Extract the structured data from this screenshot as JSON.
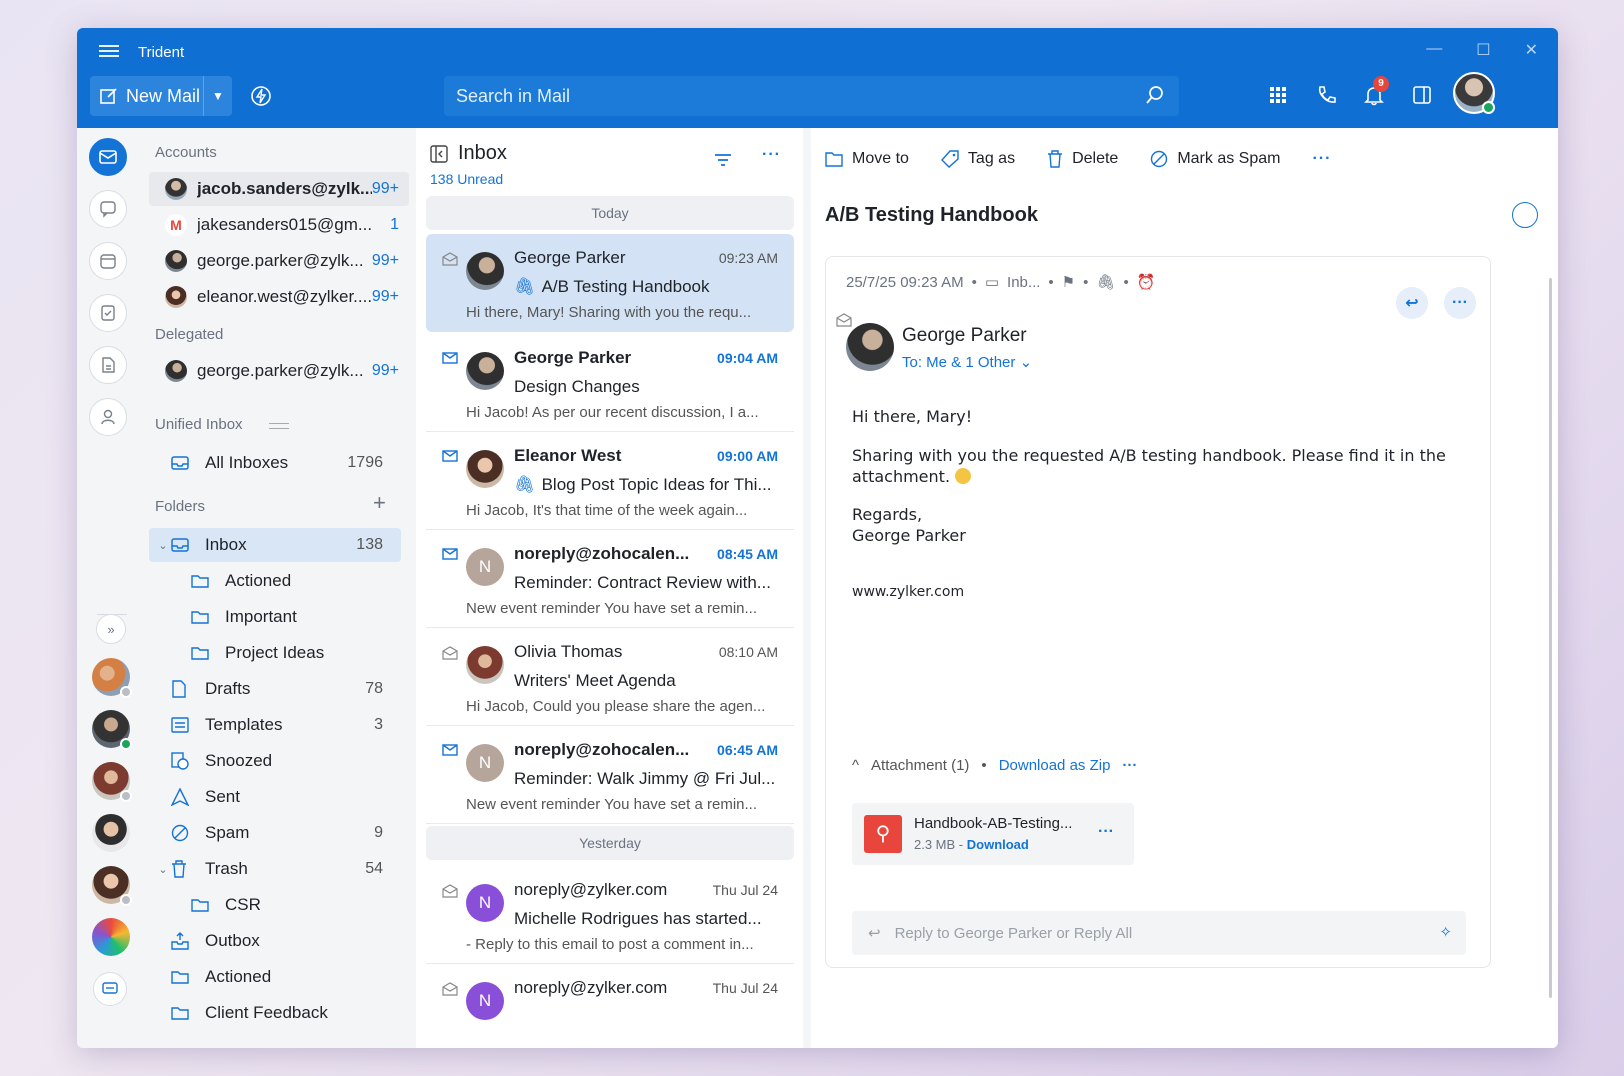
{
  "app": {
    "title": "Trident"
  },
  "toolbar_top": {
    "new_mail": "New Mail",
    "search_placeholder": "Search in Mail",
    "notification_count": "9"
  },
  "accounts": {
    "label": "Accounts",
    "items": [
      {
        "name": "jacob.sanders@zylk...",
        "count": "99+"
      },
      {
        "name": "jakesanders015@gm...",
        "count": "1"
      },
      {
        "name": "george.parker@zylk...",
        "count": "99+"
      },
      {
        "name": "eleanor.west@zylker....",
        "count": "99+"
      }
    ],
    "delegated_label": "Delegated",
    "delegated": [
      {
        "name": "george.parker@zylk...",
        "count": "99+"
      }
    ]
  },
  "unified": {
    "label": "Unified Inbox",
    "all_inboxes": "All Inboxes",
    "all_count": "1796"
  },
  "folders": {
    "label": "Folders",
    "items": [
      {
        "name": "Inbox",
        "count": "138"
      },
      {
        "name": "Actioned",
        "count": ""
      },
      {
        "name": "Important",
        "count": ""
      },
      {
        "name": "Project Ideas",
        "count": ""
      },
      {
        "name": "Drafts",
        "count": "78"
      },
      {
        "name": "Templates",
        "count": "3"
      },
      {
        "name": "Snoozed",
        "count": ""
      },
      {
        "name": "Sent",
        "count": ""
      },
      {
        "name": "Spam",
        "count": "9"
      },
      {
        "name": "Trash",
        "count": "54"
      },
      {
        "name": "CSR",
        "count": ""
      },
      {
        "name": "Outbox",
        "count": ""
      },
      {
        "name": "Actioned",
        "count": ""
      },
      {
        "name": "Client Feedback",
        "count": ""
      }
    ]
  },
  "list": {
    "title": "Inbox",
    "unread": "138 Unread",
    "today": "Today",
    "yesterday": "Yesterday",
    "mails": [
      {
        "from": "George Parker",
        "time": "09:23 AM",
        "subject": "A/B Testing Handbook",
        "preview": "Hi there, Mary! Sharing with you the requ...",
        "initial": ""
      },
      {
        "from": "George Parker",
        "time": "09:04 AM",
        "subject": "Design Changes",
        "preview": "Hi Jacob! As per our recent discussion, I a...",
        "initial": ""
      },
      {
        "from": "Eleanor West",
        "time": "09:00 AM",
        "subject": "Blog Post Topic Ideas for Thi...",
        "preview": "Hi Jacob, It's that time of the week again...",
        "initial": ""
      },
      {
        "from": "noreply@zohocalen...",
        "time": "08:45 AM",
        "subject": "Reminder: Contract Review with...",
        "preview": "New event reminder You have set a remin...",
        "initial": "N"
      },
      {
        "from": "Olivia Thomas",
        "time": "08:10 AM",
        "subject": "Writers' Meet Agenda",
        "preview": "Hi Jacob, Could you please share the agen...",
        "initial": ""
      },
      {
        "from": "noreply@zohocalen...",
        "time": "06:45 AM",
        "subject": "Reminder: Walk Jimmy @ Fri Jul...",
        "preview": "New event reminder You have set a remin...",
        "initial": "N"
      },
      {
        "from": "noreply@zylker.com",
        "time": "Thu Jul 24",
        "subject": "Michelle Rodrigues has started...",
        "preview": "- Reply to this email to post a comment in...",
        "initial": "N"
      },
      {
        "from": "noreply@zylker.com",
        "time": "Thu Jul 24",
        "subject": "",
        "preview": "",
        "initial": "N"
      }
    ]
  },
  "reader": {
    "actions": {
      "move": "Move to",
      "tag": "Tag as",
      "delete": "Delete",
      "spam": "Mark as Spam"
    },
    "subject": "A/B Testing Handbook",
    "meta_date": "25/7/25 09:23 AM",
    "meta_folder": "Inb...",
    "sender": "George Parker",
    "to": "To: Me & 1 Other",
    "greeting": "Hi there, Mary!",
    "body": "Sharing with you the requested A/B testing handbook. Please find it in the attachment.",
    "regards": "Regards,",
    "signature": "George Parker",
    "url": "www.zylker.com",
    "attachment_label": "Attachment (1)",
    "download_zip": "Download as Zip",
    "file_name": "Handbook-AB-Testing...",
    "file_size": "2.3 MB - ",
    "file_download": "Download",
    "reply_placeholder": "Reply to George Parker or Reply All"
  }
}
